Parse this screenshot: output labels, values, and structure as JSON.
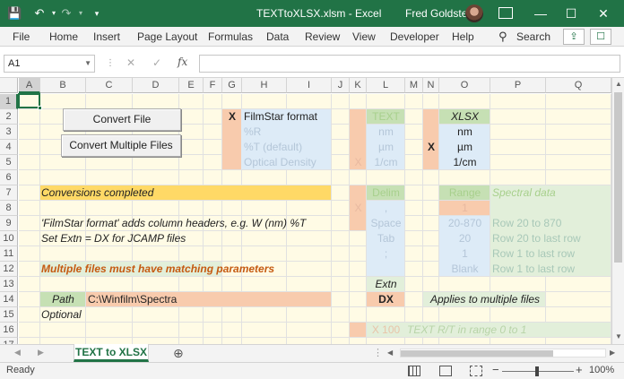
{
  "window": {
    "title": "TEXTtoXLSX.xlsm  -  Excel",
    "user": "Fred Goldstein",
    "minimize": "—",
    "maximize": "☐",
    "close": "✕"
  },
  "qat": {
    "save": "💾",
    "undo": "↶",
    "redo": "↷",
    "customize": "▾"
  },
  "ribbon": {
    "tabs": [
      "File",
      "Home",
      "Insert",
      "Page Layout",
      "Formulas",
      "Data",
      "Review",
      "View",
      "Developer",
      "Help"
    ],
    "search_label": "Search",
    "search_icon": "⚲"
  },
  "formula_bar": {
    "name_box": "A1",
    "cancel": "✕",
    "enter": "✓",
    "fx": "fx",
    "value": ""
  },
  "columns": [
    "A",
    "B",
    "C",
    "D",
    "E",
    "F",
    "G",
    "H",
    "I",
    "J",
    "K",
    "L",
    "M",
    "N",
    "O",
    "P",
    "Q"
  ],
  "rows": [
    "1",
    "2",
    "3",
    "4",
    "5",
    "6",
    "7",
    "8",
    "9",
    "10",
    "11",
    "12",
    "13",
    "14",
    "15",
    "16",
    "17"
  ],
  "buttons": {
    "convert_file": "Convert File",
    "convert_multiple": "Convert Multiple Files"
  },
  "cells": {
    "G2": "X",
    "H2": "FilmStar format",
    "H3": "%R",
    "H4": "%T (default)",
    "H5": "Optical Density",
    "K5": "X",
    "L2": "TEXT",
    "L3": "nm",
    "L4": "µm",
    "L5": "1/cm",
    "O2": "XLSX",
    "O3": "nm",
    "N4": "X",
    "O4": "µm",
    "O5": "1/cm",
    "B7": "Conversions completed",
    "L7": "Delim",
    "O7": "Range",
    "P7": "Spectral data",
    "K8": "X",
    "L8": ",",
    "O8": "1",
    "B9": "'FilmStar format' adds column headers, e.g. W (nm)  %T",
    "L9": "Space",
    "O9": "20-870",
    "P9": "Row 20 to 870",
    "B10": "Set Extn = DX for JCAMP files",
    "L10": "Tab",
    "O10": "20",
    "P10": "Row 20 to last row",
    "L11": ";",
    "O11": "1",
    "P11": "Row 1 to last row",
    "B12": "Multiple files must have matching parameters",
    "O12": "Blank",
    "P12": "Row 1 to last row",
    "L13": "Extn",
    "B14": "Path",
    "C14": "C:\\Winfilm\\Spectra",
    "L14": "DX",
    "N14": "Applies to multiple files",
    "B15": "Optional",
    "L16": "X 100",
    "M16": "TEXT R/T in range 0 to 1"
  },
  "sheet_tabs": {
    "active": "TEXT to XLSX",
    "add": "⊕",
    "prev": "◀",
    "next": "▶",
    "more": "⋮"
  },
  "status": {
    "ready": "Ready",
    "zoom": "100%",
    "zoom_minus": "−",
    "zoom_plus": "+"
  },
  "colors": {
    "excel_green": "#217346",
    "peach": "#f8cbad",
    "light_blue": "#ddebf7",
    "light_green": "#e2efda",
    "green": "#c6e0b4",
    "gold": "#ffd966",
    "cream": "#fffbe5",
    "orange_text": "#c55a11"
  }
}
